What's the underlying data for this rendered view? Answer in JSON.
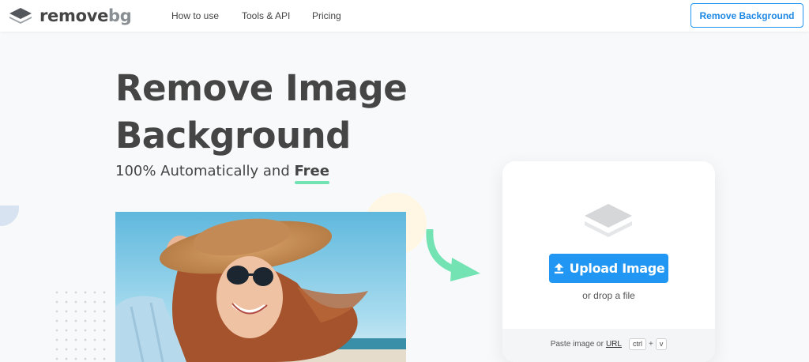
{
  "brand": {
    "remove": "remove",
    "bg": "bg",
    "accent": "#2196f3",
    "green": "#74e3b4"
  },
  "nav": {
    "items": [
      "How to use",
      "Tools & API",
      "Pricing"
    ]
  },
  "header": {
    "cta_label": "Remove Background"
  },
  "hero": {
    "title_line1": "Remove Image",
    "title_line2": "Background",
    "subtitle_prefix": "100% Automatically and ",
    "subtitle_emph": "Free"
  },
  "upload": {
    "button_label": "Upload Image",
    "button_icon": "upload-icon",
    "drop_text": "or drop a file",
    "paste_prefix": "Paste image or",
    "url_label": "URL",
    "shortcut_key1": "ctrl",
    "shortcut_plus": "+",
    "shortcut_key2": "v"
  },
  "icons": [
    "logo-layers-icon",
    "upload-icon",
    "curved-arrow-icon",
    "layers-icon"
  ]
}
